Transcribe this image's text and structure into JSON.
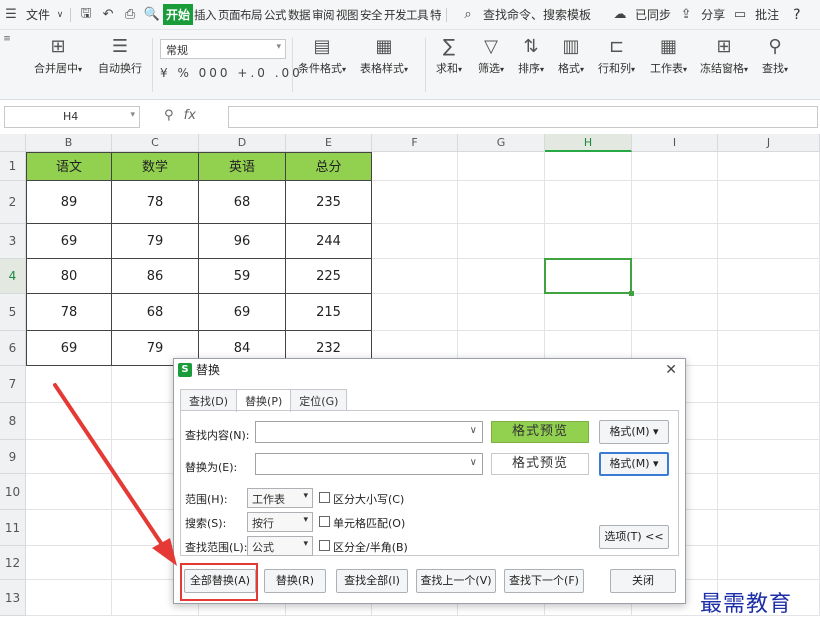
{
  "menubar": {
    "menu_icon": "hamburger-icon",
    "file_label": "文件",
    "tab_start": "开始",
    "tabs": [
      "插入",
      "页面布局",
      "公式",
      "数据",
      "审阅",
      "视图",
      "安全",
      "开发工具",
      "特"
    ],
    "search_label": "查找命令、搜索模板",
    "sync_label": "已同步",
    "share_label": "分享",
    "comment_label": "批注",
    "help_label": "?"
  },
  "ribbon": {
    "merge_label": "合并居中",
    "wrap_label": "自动换行",
    "number_format": "常规",
    "number_buttons": "¥ % 000 +.0 .00",
    "cond_format": "条件格式",
    "table_style": "表格样式",
    "sum": "求和",
    "filter": "筛选",
    "sort": "排序",
    "format": "格式",
    "rows_cols": "行和列",
    "worksheet": "工作表",
    "freeze": "冻结窗格",
    "find": "查找"
  },
  "formula_bar": {
    "cell_ref": "H4",
    "fx": "fx",
    "value": ""
  },
  "sheet": {
    "columns": [
      "B",
      "C",
      "D",
      "E",
      "F",
      "G",
      "H",
      "I",
      "J"
    ],
    "rows": [
      "1",
      "2",
      "3",
      "4",
      "5",
      "6",
      "7",
      "8",
      "9",
      "10",
      "11",
      "12",
      "13"
    ],
    "selected_col": "H",
    "selected_row": "4",
    "header": [
      "语文",
      "数学",
      "英语",
      "总分"
    ],
    "data": [
      [
        "89",
        "78",
        "68",
        "235"
      ],
      [
        "69",
        "79",
        "96",
        "244"
      ],
      [
        "80",
        "86",
        "59",
        "225"
      ],
      [
        "78",
        "68",
        "69",
        "215"
      ],
      [
        "69",
        "79",
        "84",
        "232"
      ]
    ],
    "header_color": "#92d050"
  },
  "dialog": {
    "title": "替换",
    "tabs": [
      "查找(D)",
      "替换(P)",
      "定位(G)"
    ],
    "active_tab": "替换(P)",
    "find_label": "查找内容(N):",
    "find_value": "",
    "replace_label": "替换为(E):",
    "replace_value": "",
    "preview_label": "格式预览",
    "format_button": "格式(M)",
    "scope_label": "范围(H):",
    "scope_value": "工作表",
    "search_label": "搜索(S):",
    "search_value": "按行",
    "lookin_label": "查找范围(L):",
    "lookin_value": "公式",
    "match_case": "区分大小写(C)",
    "match_cell": "单元格匹配(O)",
    "match_width": "区分全/半角(B)",
    "options_button": "选项(T) <<",
    "buttons": [
      "全部替换(A)",
      "替换(R)",
      "查找全部(I)",
      "查找上一个(V)",
      "查找下一个(F)",
      "关闭"
    ]
  },
  "annotation": {
    "color": "#e53935"
  },
  "watermark": "最需教育"
}
